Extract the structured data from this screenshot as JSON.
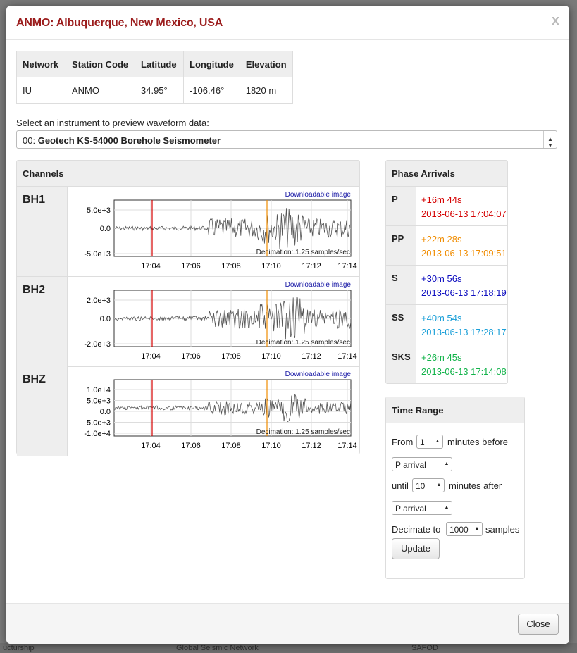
{
  "background": {
    "footer_texts": [
      "ucturship",
      "Global Seismic Network",
      "SAFOD"
    ]
  },
  "modal": {
    "title": "ANMO: Albuquerque, New Mexico, USA",
    "close_x": "x",
    "close_button": "Close"
  },
  "station_table": {
    "headers": [
      "Network",
      "Station Code",
      "Latitude",
      "Longitude",
      "Elevation"
    ],
    "row": [
      "IU",
      "ANMO",
      "34.95°",
      "-106.46°",
      "1820 m"
    ]
  },
  "instrument": {
    "label": "Select an instrument to preview waveform data:",
    "selected_prefix": "00:",
    "selected_name": "Geotech KS-54000 Borehole Seismometer"
  },
  "channels": {
    "heading": "Channels",
    "download_label": "Downloadable image",
    "decimation": "Decimation: 1.25 samples/sec",
    "time_ticks": [
      "17:04",
      "17:06",
      "17:08",
      "17:10",
      "17:12",
      "17:14"
    ],
    "items": [
      {
        "name": "BH1",
        "yticks": [
          "5.0e+3",
          "0.0",
          "-5.0e+3"
        ]
      },
      {
        "name": "BH2",
        "yticks": [
          "2.0e+3",
          "0.0",
          "-2.0e+3"
        ]
      },
      {
        "name": "BHZ",
        "yticks": [
          "1.0e+4",
          "5.0e+3",
          "0.0",
          "-5.0e+3",
          "-1.0e+4"
        ]
      }
    ]
  },
  "phase_arrivals": {
    "heading": "Phase Arrivals",
    "items": [
      {
        "name": "P",
        "offset": "+16m 44s",
        "time": "2013-06-13 17:04:07",
        "color": "#d40000"
      },
      {
        "name": "PP",
        "offset": "+22m 28s",
        "time": "2013-06-13 17:09:51",
        "color": "#f08c00"
      },
      {
        "name": "S",
        "offset": "+30m 56s",
        "time": "2013-06-13 17:18:19",
        "color": "#1010c0"
      },
      {
        "name": "SS",
        "offset": "+40m 54s",
        "time": "2013-06-13 17:28:17",
        "color": "#1a9fd8"
      },
      {
        "name": "SKS",
        "offset": "+26m 45s",
        "time": "2013-06-13 17:14:08",
        "color": "#12b34a"
      }
    ]
  },
  "time_range": {
    "heading": "Time Range",
    "from_label": "From",
    "from_value": "1",
    "before_label": "minutes before",
    "from_phase": "P arrival",
    "until_label": "until",
    "until_value": "10",
    "after_label": "minutes after",
    "until_phase": "P arrival",
    "decimate_label": "Decimate to",
    "decimate_value": "1000",
    "samples_label": "samples",
    "update_button": "Update"
  }
}
